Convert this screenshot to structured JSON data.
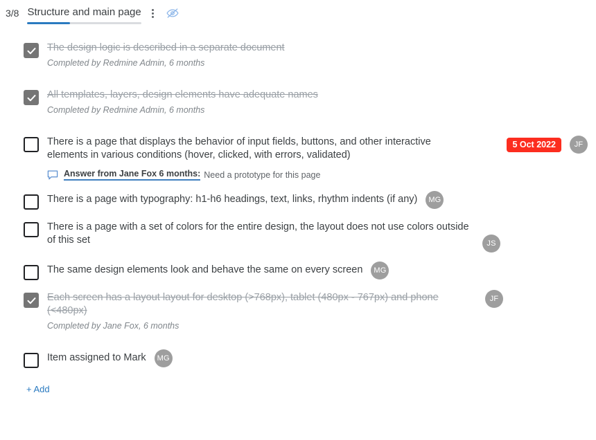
{
  "header": {
    "progress_count": "3/8",
    "title": "Structure and main page",
    "progress_percent": 37.5,
    "menu_icon": "kebab-menu-icon",
    "visibility_icon": "eye-off-icon",
    "accent_color": "#2a7ac0"
  },
  "items": [
    {
      "checked": true,
      "text": "The design logic is described in a separate document",
      "meta": "Completed by Redmine Admin, 6 months",
      "avatar": "",
      "badge": ""
    },
    {
      "checked": true,
      "text": "All templates, layers, design elements have adequate names",
      "meta": "Completed by Redmine Admin, 6 months",
      "avatar": "",
      "badge": ""
    },
    {
      "checked": false,
      "text": "There is a page that displays the behavior of input fields, buttons, and other interactive elements in various conditions (hover, clicked, with errors, validated)",
      "meta": "",
      "answer_link": "Answer from Jane Fox 6 months:",
      "answer_text": "Need a prototype for this page",
      "badge": "5 Oct 2022",
      "avatar": "JF"
    },
    {
      "checked": false,
      "text": "There is a page with typography: h1-h6 headings, text, links, rhythm indents (if any)",
      "meta": "",
      "avatar": "MG",
      "badge": ""
    },
    {
      "checked": false,
      "text": "There is a page with a set of colors for the entire design, the layout does not use colors outside of this set",
      "meta": "",
      "avatar": "JS",
      "badge": ""
    },
    {
      "checked": false,
      "text": "The same design elements look and behave the same on every screen",
      "meta": "",
      "avatar": "MG",
      "badge": ""
    },
    {
      "checked": true,
      "text": "Each screen has a layout layout for desktop (>768px), tablet (480px - 767px) and phone (<480px)",
      "meta": "Completed by Jane Fox, 6 months",
      "avatar": "JF",
      "badge": ""
    },
    {
      "checked": false,
      "text": "Item assigned to Mark",
      "meta": "",
      "avatar": "MG",
      "badge": ""
    }
  ],
  "footer": {
    "add_label": "+ Add"
  },
  "colors": {
    "badge_red": "#fc2d1f",
    "avatar_gray": "#9e9e9e",
    "checked_gray": "#757575",
    "link_blue": "#2a7ac0"
  }
}
